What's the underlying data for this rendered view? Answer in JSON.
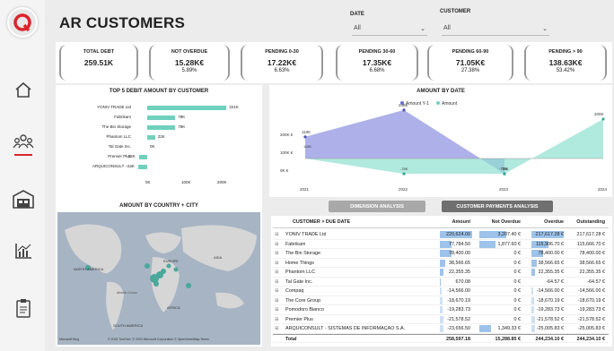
{
  "app": {
    "title": "AR CUSTOMERS",
    "brand_color": "#d9252b"
  },
  "filters": {
    "date_label": "DATE",
    "date_value": "All",
    "customer_label": "CUSTOMER",
    "customer_value": "All"
  },
  "nav": [
    "home-icon",
    "customers-icon",
    "warehouse-icon",
    "chart-icon",
    "clipboard-icon"
  ],
  "kpis": [
    {
      "label": "TOTAL DEBT",
      "value": "259.51K",
      "pct": ""
    },
    {
      "label": "NOT OVERDUE",
      "value": "15.28K€",
      "pct": "5.89%"
    },
    {
      "label": "PENDING 0-30",
      "value": "17.22K€",
      "pct": "6.63%"
    },
    {
      "label": "PENDING 30-60",
      "value": "17.35K€",
      "pct": "6.68%"
    },
    {
      "label": "PENDING 60-90",
      "value": "71.05K€",
      "pct": "27.38%"
    },
    {
      "label": "PENDING > 90",
      "value": "138.63K€",
      "pct": "53.42%"
    }
  ],
  "top5": {
    "title": "TOP 5 DEBIT AMOUNT BY CUSTOMER",
    "axis": [
      "0K",
      "100K",
      "200K"
    ],
    "rows": [
      {
        "name": "YONIV TRADE Ltd",
        "label": "221K",
        "value": 221
      },
      {
        "name": "Fabrikam",
        "label": "78K",
        "value": 78
      },
      {
        "name": "The Bin Storage",
        "label": "78K",
        "value": 78
      },
      {
        "name": "Phantom LLC",
        "label": "22K",
        "value": 22
      },
      {
        "name": "Tal Gate Inc.",
        "label": "0K",
        "value": 0
      },
      {
        "name": "Premier Plus",
        "label": "-22K",
        "value": -22
      },
      {
        "name": "ARQUICONSULT - ...",
        "label": "-24K",
        "value": -24
      }
    ]
  },
  "chart_data": {
    "type": "area",
    "title": "AMOUNT BY DATE",
    "x": [
      "2021",
      "2022",
      "2023",
      "2024"
    ],
    "series": [
      {
        "name": "Amount Y-1",
        "values": [
          110,
          246,
          -78,
          null
        ],
        "labels": [
          "110K",
          "246K",
          "-78K",
          ""
        ]
      },
      {
        "name": "Amount",
        "values": [
          null,
          -78,
          -78,
          200
        ],
        "labels": [
          "",
          "",
          "",
          "200K"
        ]
      }
    ],
    "y_ticks": [
      "200K €",
      "100K €",
      "0K €"
    ],
    "inner_labels": [
      "110K",
      "-78K",
      "-78K"
    ]
  },
  "map": {
    "title": "AMOUNT BY COUNTRY + CITY",
    "labels": [
      "NORTH AMERICA",
      "EUROPE",
      "ASIA",
      "AFRICA",
      "SOUTH AMERICA",
      "Atlantic Ocean"
    ],
    "attribution": "© 2024 TomTom, © 2024 Microsoft Corporation  © OpenStreetMap  Terms",
    "ms": "Microsoft Bing"
  },
  "buttons": {
    "dimension": "DIMENSION ANALYSIS",
    "payments": "CUSTOMER PAYMENTS ANALYSIS"
  },
  "table": {
    "headers": [
      "CUSTOMER > DUE DATE",
      "Amount",
      "Not Overdue",
      "Overdue",
      "Outstanding"
    ],
    "rows": [
      [
        "YONIV TRADE Ltd",
        "220,624.00",
        "3,207.40 €",
        "217,617.28 €",
        "217,617.28 €"
      ],
      [
        "Fabrikam",
        "77,784.50",
        "1,877.60 €",
        "115,906.70 €",
        "115,666.70 €"
      ],
      [
        "The Bin Storage",
        "78,400.00",
        "0 €",
        "78,400.00 €",
        "78,400.00 €"
      ],
      [
        "Home Things",
        "38,566.65",
        "0 €",
        "38,566.65 €",
        "38,566.65 €"
      ],
      [
        "Phantom LLC",
        "22,355.35",
        "0 €",
        "22,355.35 €",
        "22,355.35 €"
      ],
      [
        "Tal Gate Inc.",
        "670.08",
        "0 €",
        "-64.57 €",
        "-64.57 €"
      ],
      [
        "Compaq",
        "-14,566.00",
        "0 €",
        "-14,566.00 €",
        "-14,566.00 €"
      ],
      [
        "The Core Group",
        "-18,670.19",
        "0 €",
        "-18,670.19 €",
        "-18,670.19 €"
      ],
      [
        "Pomodoro Bianco",
        "-19,283.73",
        "0 €",
        "-19,283.73 €",
        "-19,283.73 €"
      ],
      [
        "Premier Plus",
        "-21,578.52",
        "0 €",
        "-21,578.52 €",
        "-21,578.52 €"
      ],
      [
        "ARQUICONSULT - SISTEMAS DE INFORMAÇÃO S.A.",
        "-23,656.50",
        "1,349.33 €",
        "-25,005.83 €",
        "-25,005.83 €"
      ]
    ],
    "total": [
      "Total",
      "258,597.18",
      "15,288.85 €",
      "244,234.10 €",
      "244,234.10 €"
    ]
  }
}
